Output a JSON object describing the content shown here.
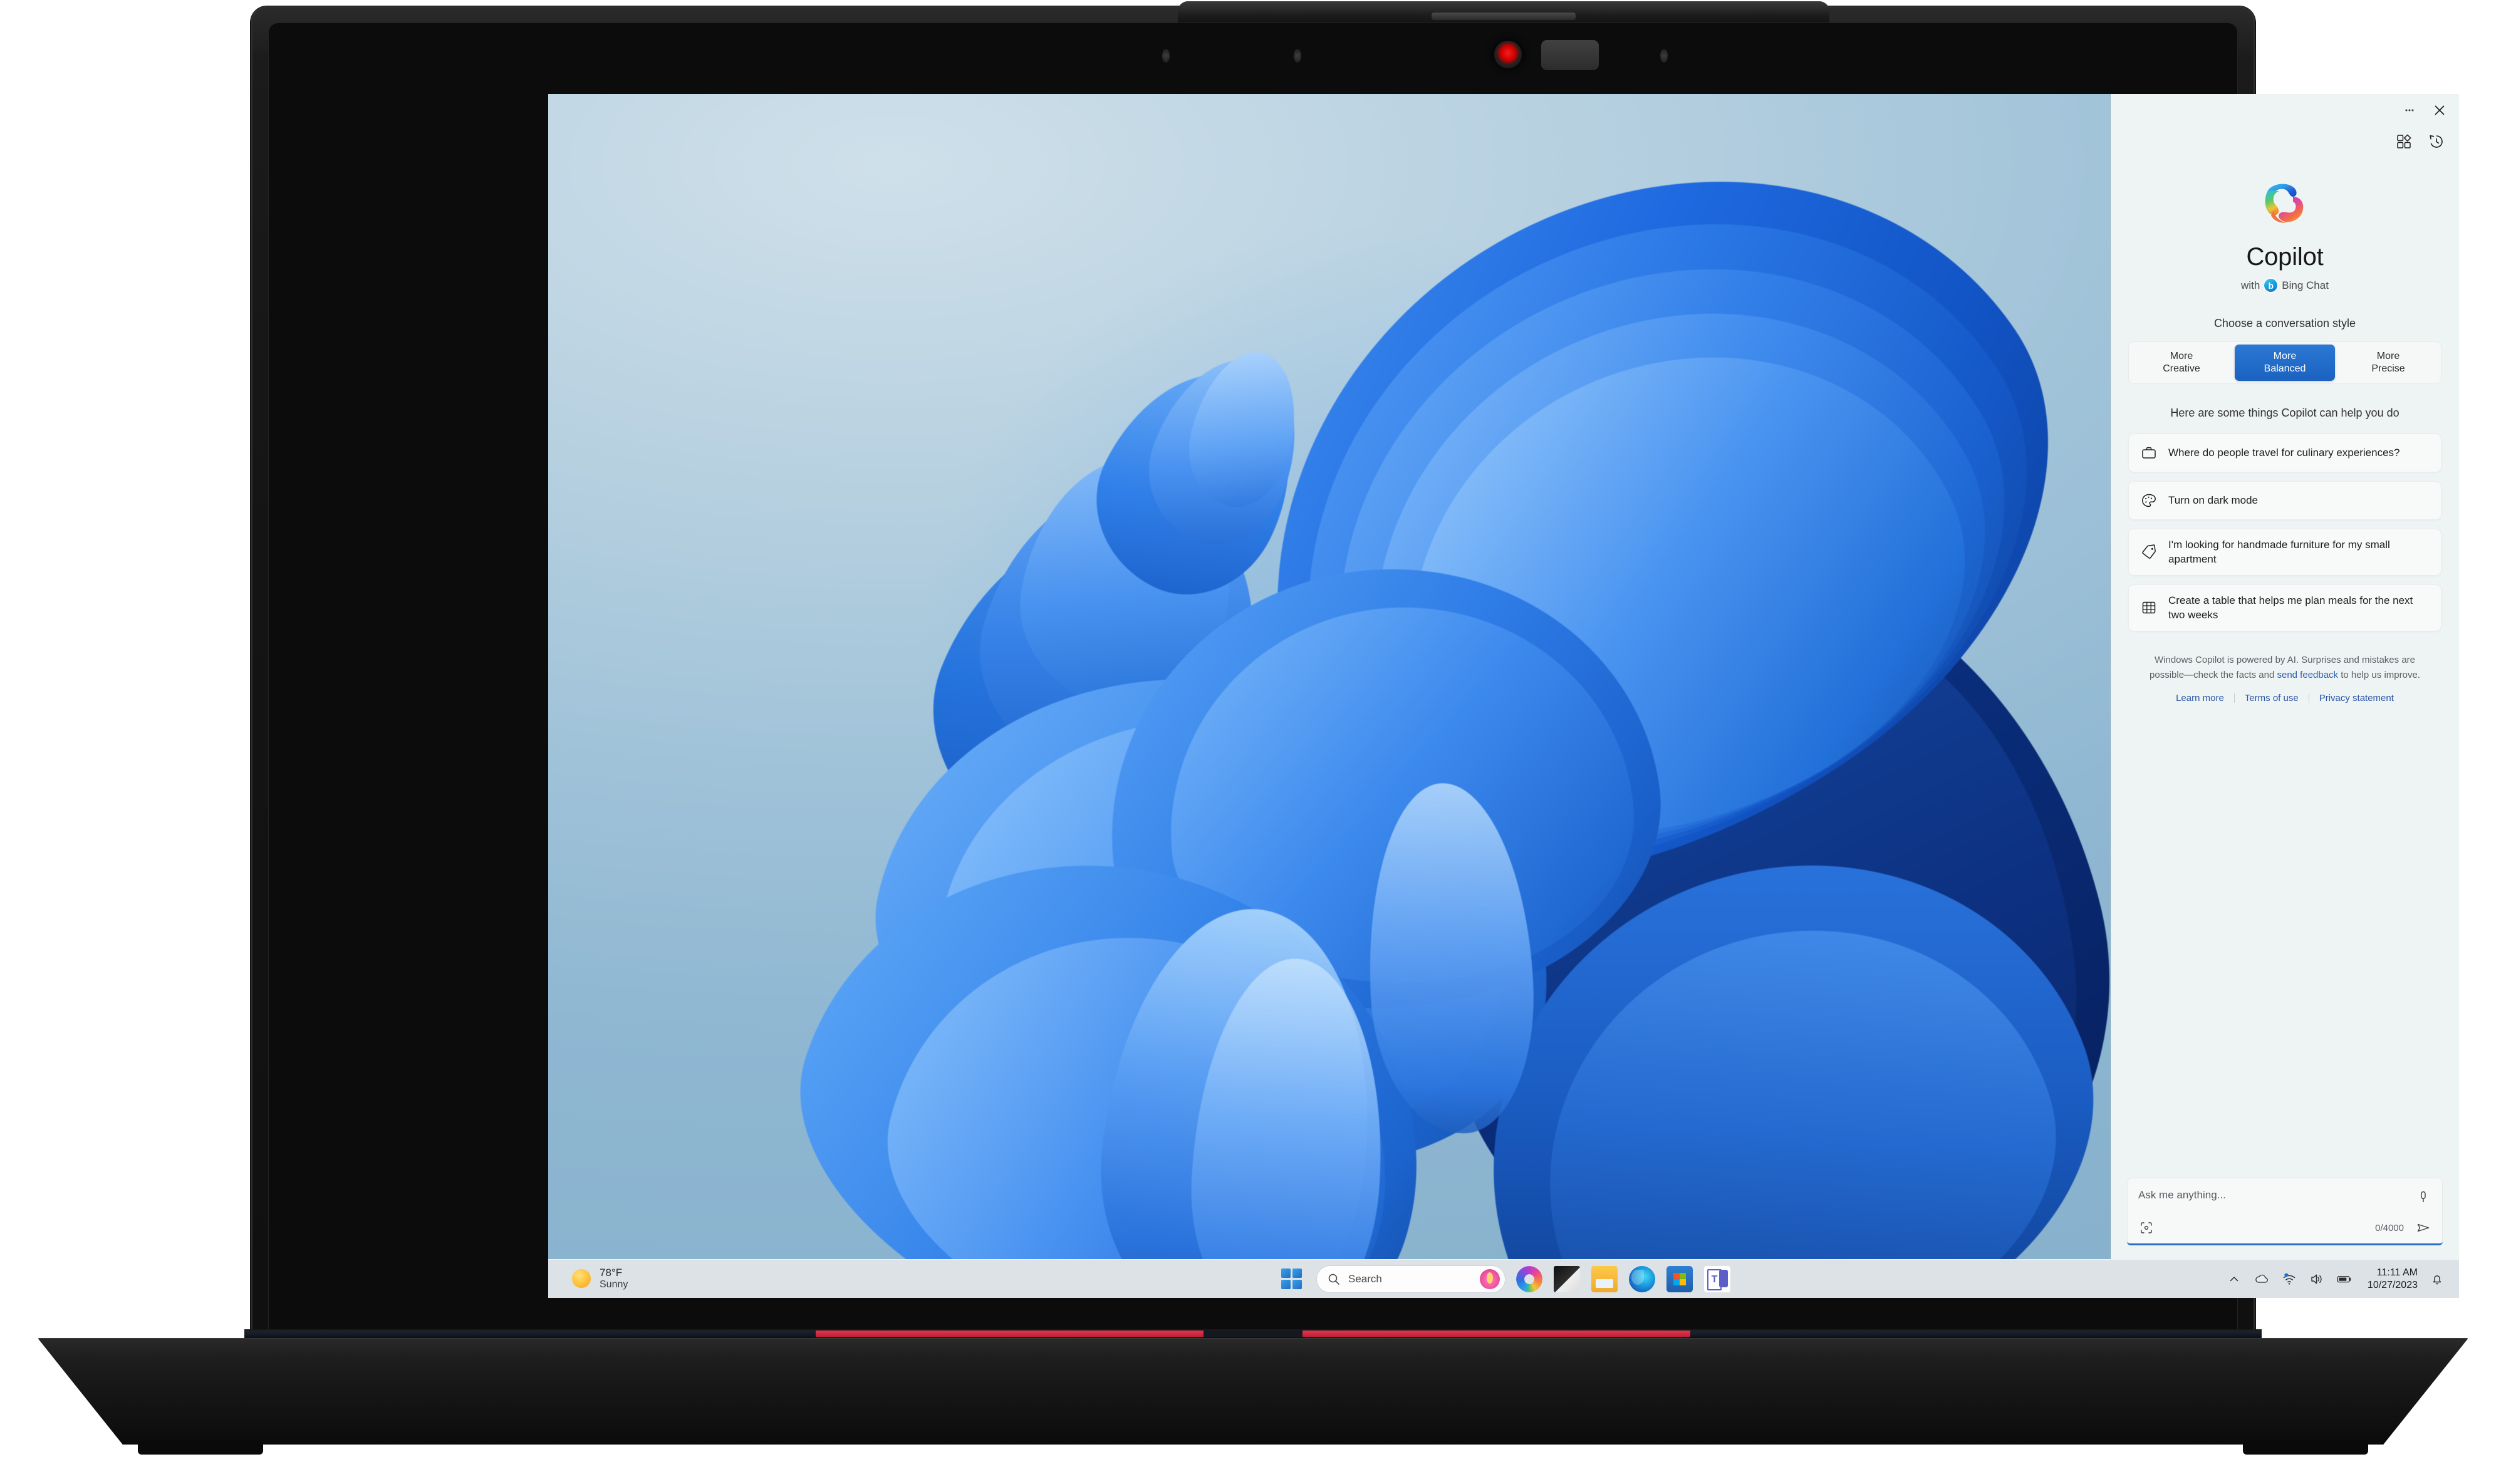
{
  "device": {
    "name": "thinkpad-laptop",
    "camera_label": "webcam",
    "brand_accent": "#e2231a"
  },
  "desktop": {
    "wallpaper_name": "windows-11-bloom",
    "bg_color": "#8fb7d2"
  },
  "taskbar": {
    "weather": {
      "temperature": "78°F",
      "condition": "Sunny",
      "icon": "sun-icon"
    },
    "start_label": "Start",
    "search": {
      "placeholder": "Search",
      "icon": "search-icon",
      "highlight_icon": "lotus-icon"
    },
    "apps": [
      {
        "name": "copilot",
        "label": "Copilot",
        "icon": "copilot-icon"
      },
      {
        "name": "lenovo-vantage",
        "label": "Lenovo",
        "icon": "lenovo-icon"
      },
      {
        "name": "file-explorer",
        "label": "File Explorer",
        "icon": "folder-icon"
      },
      {
        "name": "edge",
        "label": "Microsoft Edge",
        "icon": "edge-icon"
      },
      {
        "name": "microsoft-store",
        "label": "Microsoft Store",
        "icon": "store-icon"
      },
      {
        "name": "teams",
        "label": "Microsoft Teams",
        "icon": "teams-icon"
      }
    ],
    "tray": {
      "overflow_icon": "chevron-up-icon",
      "onedrive_icon": "cloud-icon",
      "network_icon": "wifi-icon",
      "volume_icon": "speaker-icon",
      "battery_icon": "battery-icon",
      "time": "11:11 AM",
      "date": "10/27/2023",
      "notifications_icon": "bell-icon"
    }
  },
  "copilot": {
    "titlebar": {
      "more_label": "···",
      "more_icon": "ellipsis-icon",
      "close_label": "✕",
      "close_icon": "close-icon"
    },
    "tools": {
      "plugins_icon": "plugins-icon",
      "history_icon": "history-icon"
    },
    "hero": {
      "logo_icon": "copilot-logo-icon",
      "title": "Copilot",
      "subtitle_prefix": "with",
      "subtitle_badge": "b",
      "subtitle_suffix": "Bing Chat"
    },
    "style": {
      "label": "Choose a conversation style",
      "options": [
        {
          "line1": "More",
          "line2": "Creative",
          "active": false
        },
        {
          "line1": "More",
          "line2": "Balanced",
          "active": true
        },
        {
          "line1": "More",
          "line2": "Precise",
          "active": false
        }
      ],
      "active_color": "#1b62c0"
    },
    "suggestions": {
      "label": "Here are some things Copilot can help you do",
      "items": [
        {
          "icon": "briefcase-icon",
          "text": "Where do people travel for culinary experiences?"
        },
        {
          "icon": "palette-icon",
          "text": "Turn on dark mode"
        },
        {
          "icon": "tag-icon",
          "text": "I'm looking for handmade furniture for my small apartment"
        },
        {
          "icon": "table-icon",
          "text": "Create a table that helps me plan meals for the next two weeks"
        }
      ]
    },
    "disclaimer": {
      "part1": "Windows Copilot is powered by AI. Surprises and mistakes are possible—check the facts and ",
      "link": "send feedback",
      "part2": " to help us improve."
    },
    "links": [
      {
        "label": "Learn more"
      },
      {
        "label": "Terms of use"
      },
      {
        "label": "Privacy statement"
      }
    ],
    "input": {
      "placeholder": "Ask me anything...",
      "mic_icon": "microphone-icon",
      "scan_icon": "scan-icon",
      "counter": "0/4000",
      "send_icon": "send-icon",
      "accent_color": "#2a6fc4"
    }
  }
}
